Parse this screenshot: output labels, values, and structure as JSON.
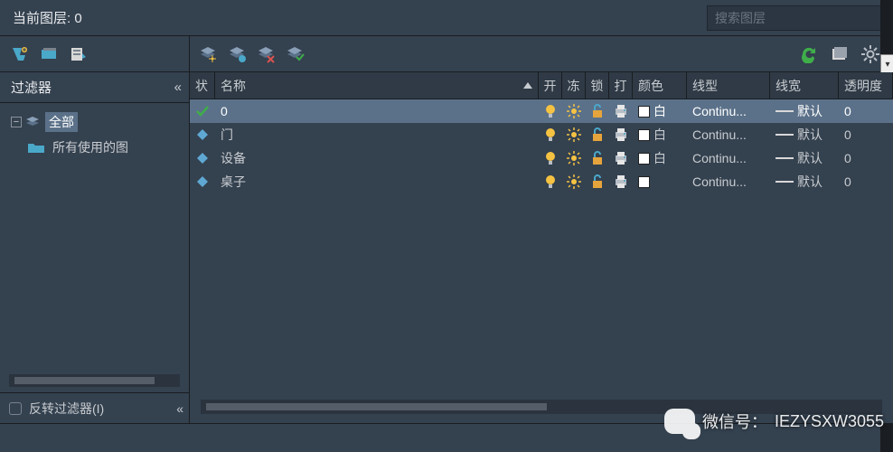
{
  "header": {
    "title_prefix": "当前图层:",
    "current_layer": "0"
  },
  "search": {
    "placeholder": "搜索图层"
  },
  "sidebar": {
    "title": "过滤器",
    "root_label": "全部",
    "child_label": "所有使用的图",
    "invert_label": "反转过滤器(I)"
  },
  "columns": {
    "status": "状",
    "name": "名称",
    "on": "开",
    "freeze": "冻",
    "lock": "锁",
    "plot": "打",
    "color": "颜色",
    "linetype": "线型",
    "lineweight": "线宽",
    "opacity": "透明度"
  },
  "rows": [
    {
      "current": true,
      "name": "0",
      "on": true,
      "freeze": false,
      "lock": false,
      "plot": true,
      "color_swatch": "#ffffff",
      "color_name": "白",
      "linetype": "Continu...",
      "lineweight": "默认",
      "opacity": "0"
    },
    {
      "current": false,
      "name": "门",
      "on": true,
      "freeze": false,
      "lock": false,
      "plot": true,
      "color_swatch": "#ffffff",
      "color_name": "白",
      "linetype": "Continu...",
      "lineweight": "默认",
      "opacity": "0"
    },
    {
      "current": false,
      "name": "设备",
      "on": true,
      "freeze": false,
      "lock": false,
      "plot": true,
      "color_swatch": "#ffffff",
      "color_name": "白",
      "linetype": "Continu...",
      "lineweight": "默认",
      "opacity": "0"
    },
    {
      "current": false,
      "name": "桌子",
      "on": true,
      "freeze": false,
      "lock": false,
      "plot": true,
      "color_swatch": "#ffffff",
      "color_name": "",
      "linetype": "Continu...",
      "lineweight": "默认",
      "opacity": "0"
    }
  ],
  "watermark": {
    "label": "微信号：",
    "id": "IEZYSXW3055"
  }
}
